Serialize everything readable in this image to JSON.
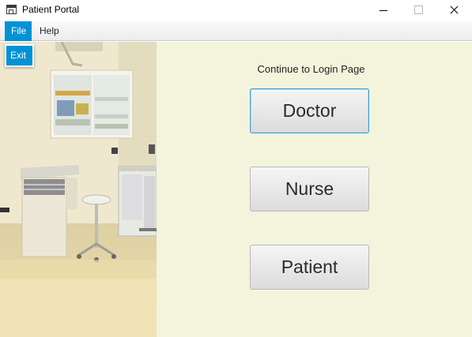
{
  "window": {
    "title": "Patient Portal"
  },
  "menubar": {
    "file_label": "File",
    "help_label": "Help"
  },
  "file_menu": {
    "items": [
      {
        "label": "Exit"
      }
    ]
  },
  "main": {
    "prompt": "Continue to Login Page",
    "buttons": [
      {
        "label": "Doctor"
      },
      {
        "label": "Nurse"
      },
      {
        "label": "Patient"
      }
    ]
  },
  "icons": {
    "minimize": "minimize-icon",
    "maximize": "maximize-icon",
    "close": "close-icon",
    "app": "app-window-icon"
  },
  "colors": {
    "menu_highlight": "#0092d6",
    "panel_background": "#f4f4dc",
    "focus_border": "#3a9ed6"
  }
}
